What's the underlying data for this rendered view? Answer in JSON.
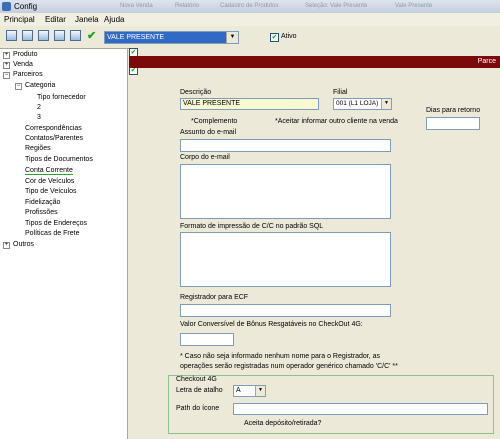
{
  "window": {
    "title": "Config",
    "background_tabs": [
      "Nova Venda",
      "Relatório",
      "Cadastro de Produtos",
      "Seleção: Vale Presente",
      "Vale Presente"
    ]
  },
  "menu": [
    "Principal",
    "Editar",
    "Janela",
    "Ajuda"
  ],
  "toolbar": {
    "record_select": "VALE PRESENTE",
    "ativo_label": "Ativo",
    "ativo_checked": true
  },
  "tree": {
    "produto": "Produto",
    "venda": "Venda",
    "parceiros": "Parceiros",
    "categoria": "Categoria",
    "tipo_fornecedor": "Tipo fornecedor",
    "cat_2": "2",
    "cat_3": "3",
    "correspondencias": "Correspondências",
    "contatos": "Contatos/Parentes",
    "regioes": "Regiões",
    "tipos_documentos": "Tipos de Documentos",
    "conta_corrente": "Conta Corrente",
    "cor_veiculos": "Cor de Veículos",
    "tipo_veiculos": "Tipo de Veículos",
    "fidelizacao": "Fidelização",
    "profissoes": "Profissões",
    "tipos_enderecos": "Tipos de Endereços",
    "politicas_frete": "Políticas de Frete",
    "outros": "Outros"
  },
  "header": {
    "title": "Parce"
  },
  "form": {
    "descricao_label": "Descrição",
    "descricao_value": "VALE PRESENTE",
    "filial_label": "Filial",
    "filial_value": "001 (L1 LOJA)",
    "dias_retorno_label": "Dias para retorno",
    "dias_retorno_value": "",
    "complemento_label": "*Complemento",
    "complemento_checked": true,
    "aceitar_label": "*Aceitar informar outro cliente na venda",
    "aceitar_checked": false,
    "assunto_label": "Assunto do e-mail",
    "corpo_label": "Corpo do e-mail",
    "formato_label": "Formato de impressão de C/C no padrão SQL",
    "registrador_label": "Registrador para ECF",
    "valor_label": "Valor Conversível de Bônus Resgatáveis no CheckOut 4G:",
    "note_line1": "* Caso não seja informado nenhum nome para o Registrador, as",
    "note_line2": "operações serão registradas num operador genérico chamado 'C/C' **",
    "checkout_title": "Checkout 4G",
    "letra_label": "Letra de atalho",
    "letra_value": "A",
    "path_label": "Path do ícone",
    "aceita_label": "Aceita depósito/retirada?",
    "aceita_checked": true
  }
}
